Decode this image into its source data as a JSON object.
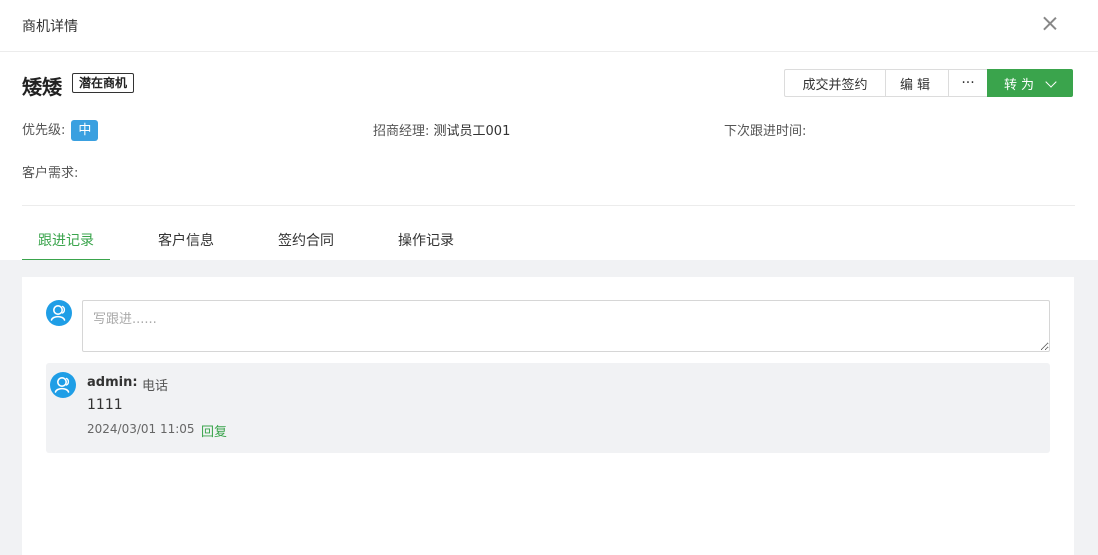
{
  "dialog": {
    "title": "商机详情"
  },
  "header": {
    "name": "矮矮",
    "tag": "潜在商机",
    "buttons": {
      "deal": "成交并签约",
      "edit": "编辑",
      "more": "···",
      "convert": "转为"
    }
  },
  "fields": {
    "priority_label": "优先级:",
    "priority_value": "中",
    "manager_label": "招商经理:",
    "manager_value": "测试员工001",
    "next_follow_label": "下次跟进时间:",
    "next_follow_value": "",
    "need_label": "客户需求:",
    "need_value": ""
  },
  "tabs": [
    {
      "label": "跟进记录",
      "active": true
    },
    {
      "label": "客户信息",
      "active": false
    },
    {
      "label": "签约合同",
      "active": false
    },
    {
      "label": "操作记录",
      "active": false
    }
  ],
  "follow": {
    "placeholder": "写跟进......",
    "value": ""
  },
  "records": [
    {
      "user": "admin:",
      "type": "电话",
      "content": "1111",
      "time": "2024/03/01 11:05",
      "reply_label": "回复"
    }
  ],
  "colors": {
    "accent": "#3aa44c",
    "priority": "#3aa0e0",
    "avatar": "#1f9ee6"
  }
}
